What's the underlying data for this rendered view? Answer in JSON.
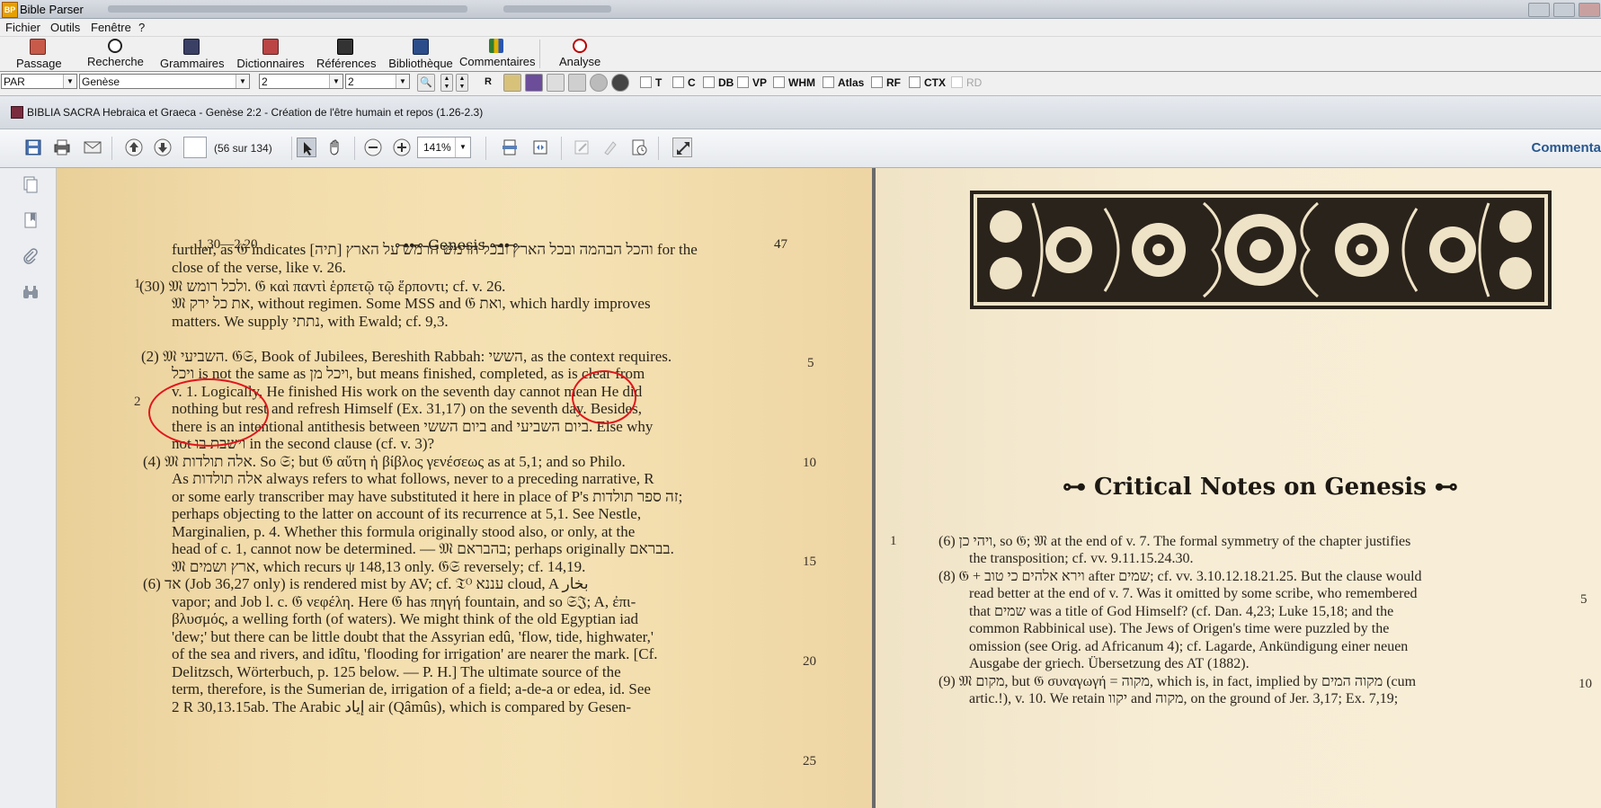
{
  "app": {
    "title": "Bible Parser",
    "icon_label": "BP"
  },
  "menubar": {
    "items": [
      "Fichier",
      "Outils",
      "Fenêtre",
      "?"
    ]
  },
  "toolbar": {
    "buttons": [
      "Passage",
      "Recherche",
      "Grammaires",
      "Dictionnaires",
      "Références",
      "Bibliothèque",
      "Commentaires",
      "Analyse"
    ]
  },
  "selectors": {
    "version": "PAR",
    "book": "Genèse",
    "chapter": "2",
    "verse": "2",
    "r_label": "R"
  },
  "checkboxes": [
    {
      "label": "T",
      "enabled": true
    },
    {
      "label": "C",
      "enabled": true
    },
    {
      "label": "DB",
      "enabled": true
    },
    {
      "label": "VP",
      "enabled": true
    },
    {
      "label": "WHM",
      "enabled": true
    },
    {
      "label": "Atlas",
      "enabled": true
    },
    {
      "label": "RF",
      "enabled": true
    },
    {
      "label": "CTX",
      "enabled": true
    },
    {
      "label": "RD",
      "enabled": false
    }
  ],
  "document": {
    "title": "BIBLIA SACRA Hebraica et Graeca - Genèse 2:2 - Création de l'être humain et repos (1.26-2.3)",
    "page_count": "(56 sur 134)",
    "page_number": "",
    "zoom": "141%",
    "comment_link": "Commenta"
  },
  "left_page": {
    "running_head_left": "1,30—2,20",
    "running_head_title": "⊶⊷ Genesis ⊶⊷",
    "page_number": "47",
    "verse_markers": [
      "1",
      "2"
    ],
    "line_numbers": [
      "5",
      "10",
      "15",
      "20",
      "25"
    ],
    "lines": [
      "further, as 𝔊 indicates והכל הבהמה ובכל הארץ ובכל הרמש הרמש על הארץ [תיה] for the",
      "close of the verse, like v. 26.",
      "(30) 𝔐 ולכל רומש. 𝔊 καὶ παντὶ ἑρπετῷ τῷ ἕρποντι; cf. v. 26.",
      "𝔐 את כל ירק, without regimen. Some MSS and 𝔊 ואת, which hardly improves",
      "matters. We supply נתתי, with Ewald; cf. 9,3.",
      "(2) 𝔐 השביעי. 𝔊𝔖, Book of Jubilees, Bereshith Rabbah: הששי, as the context requires.",
      "ויכל is not the same as ויכל מן, but means finished, completed, as is clear from",
      "v. 1. Logically, He finished His work on the seventh day cannot mean He did",
      "nothing but rest and refresh Himself (Ex. 31,17) on the seventh day. Besides,",
      "there is an intentional antithesis between ביום הששי and ביום השביעי. Else why",
      "not וישבת בו in the second clause (cf. v. 3)?",
      "(4) 𝔐 אלה תולדות. So 𝔖; but 𝔊 αὕτη ἡ βίβλος γενέσεως as at 5,1; and so Philo.",
      "As אלה תולדות always refers to what follows, never to a preceding narrative, R",
      "or some early transcriber may have substituted it here in place of P's זה ספר תולדות;",
      "perhaps objecting to the latter on account of its recurrence at 5,1. See Nestle,",
      "Marginalien, p. 4. Whether this formula originally stood also, or only, at the",
      "head of c. 1, cannot now be determined. — 𝔐 בהבראם; perhaps originally בבראם.",
      "𝔐 ארץ ושמים, which recurs ψ 148,13 only. 𝔊𝔖 reversely; cf. 14,19.",
      "(6) אד (Job 36,27 only) is rendered mist by AV; cf. 𝔗ᴼ עננא cloud, A بخار",
      "vapor; and Job l. c. 𝔊 νεφέλη. Here 𝔊 has πηγή fountain, and so 𝔖𝔍; A, ἐπι-",
      "βλυσμός, a welling forth (of waters). We might think of the old Egyptian iad",
      "'dew;' but there can be little doubt that the Assyrian edû, 'flow, tide, highwater,'",
      "of the sea and rivers, and idîtu, 'flooding for irrigation' are nearer the mark. [Cf.",
      "Delitzsch, Wörterbuch, p. 125 below. — P. H.] The ultimate source of the",
      "term, therefore, is the Sumerian de, irrigation of a field; a-de-a or edea, id. See",
      "2 R 30,13.15ab. The Arabic إياد air (Qâmûs), which is compared by Gesen-"
    ]
  },
  "right_page": {
    "title": "⊶ Critical Notes on Genesis ⊷",
    "verse_marker": "1",
    "line_numbers": [
      "5",
      "10"
    ],
    "lines": [
      "(6) ויהי כן, so 𝔊; 𝔐 at the end of v. 7. The formal symmetry of the chapter justifies",
      "the transposition; cf. vv. 9.11.15.24.30.",
      "(8) 𝔊 + וירא אלהים כי טוב after שמים; cf. vv. 3.10.12.18.21.25. But the clause would",
      "read better at the end of v. 7. Was it omitted by some scribe, who remembered",
      "that שמים was a title of God Himself? (cf. Dan. 4,23; Luke 15,18; and the",
      "common Rabbinical use). The Jews of Origen's time were puzzled by the",
      "omission (see Orig. ad Africanum 4); cf. Lagarde, Ankündigung einer neuen",
      "Ausgabe der griech. Übersetzung des AT (1882).",
      "(9) 𝔐 מקום, but 𝔊 συναγωγή = מקוה, which is, in fact, implied by מקוה המים (cum",
      "artic.!), v. 10. We retain יקוו and מקוה, on the ground of Jer. 3,17; Ex. 7,19;"
    ]
  },
  "colors": {
    "annotation_circle": "#e0161c",
    "accent_link": "#27578f"
  }
}
